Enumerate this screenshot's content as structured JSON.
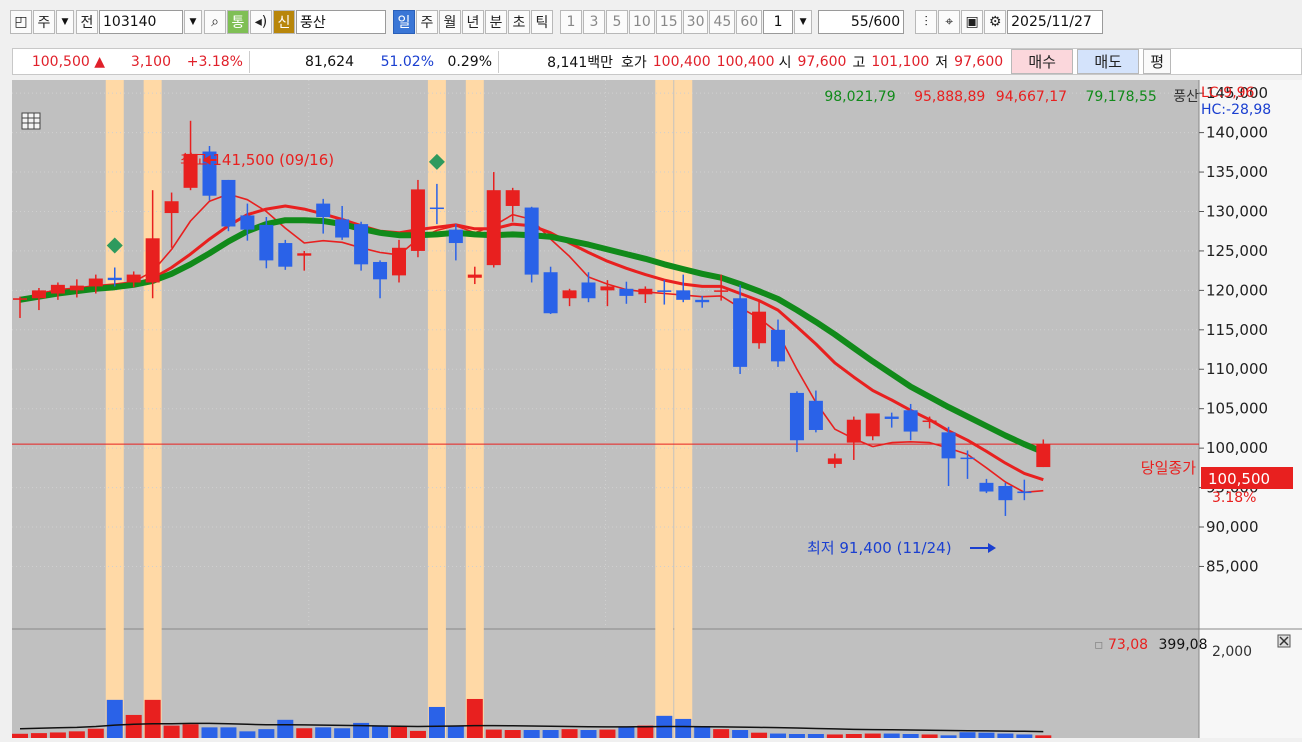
{
  "toolbar": {
    "period_primary": "주",
    "prev_label": "전",
    "code": "103140",
    "tong": "통",
    "sin": "신",
    "stock_name": "풍산",
    "periods": [
      "일",
      "주",
      "월",
      "년",
      "분",
      "초",
      "틱"
    ],
    "active_period": "일",
    "intervals": [
      "1",
      "3",
      "5",
      "10",
      "15",
      "30",
      "45",
      "60"
    ],
    "interval_value": "1",
    "count": "55",
    "count_max": "/600",
    "date": "2025/11/27"
  },
  "quote": {
    "price": "100,500",
    "change_arrow": "▲",
    "change": "3,100",
    "change_pct": "+3.18%",
    "volume": "81,624",
    "vol_ratio": "51.02%",
    "turnover_pct": "0.29%",
    "amount": "8,141백만",
    "hoga_label": "호가",
    "ask": "100,400",
    "bid": "100,400",
    "open_label": "시",
    "open": "97,600",
    "high_label": "고",
    "high": "101,100",
    "low_label": "저",
    "low": "97,600",
    "buy_label": "매수",
    "sell_label": "매도",
    "avg_label": "평"
  },
  "ma_values": {
    "ma1": "98,021,79",
    "ma2": "95,888,89",
    "ma3": "94,667,17",
    "ma4": "79,178,55",
    "name": "풍산"
  },
  "lc_label": "LC:9,96",
  "hc_label": "HC:-28,98",
  "current_label": "당일종가",
  "current_price": "100,500",
  "current_pct": "3.18%",
  "high_note": "최고 141,500 (09/16)",
  "low_note": "최저 91,400 (11/24)",
  "vol_labels": {
    "v1": "73,08",
    "v2": "399,08",
    "tick": "2,000"
  },
  "colors": {
    "up": "#e8201f",
    "down": "#2a62e8",
    "ma_red": "#e8201f",
    "ma_green": "#118a1a",
    "highlight": "#ffd9a6",
    "diamond": "#2e9a5e"
  },
  "chart_data": {
    "type": "candlestick",
    "ylim": [
      81000,
      147000
    ],
    "yticks": [
      85000,
      90000,
      95000,
      100000,
      105000,
      110000,
      115000,
      120000,
      125000,
      130000,
      135000,
      140000,
      145000
    ],
    "yticks_labels": [
      "85,000",
      "90,000",
      "95,000",
      "100,000",
      "105,000",
      "110,000",
      "115,000",
      "120,000",
      "125,000",
      "130,000",
      "135,000",
      "140,000",
      "145,000"
    ],
    "ohlc": [
      [
        118800,
        119200,
        116500,
        119000
      ],
      [
        119000,
        120300,
        117500,
        120000
      ],
      [
        119600,
        121000,
        118800,
        120700
      ],
      [
        120000,
        121400,
        119100,
        120600
      ],
      [
        120500,
        122000,
        119600,
        121500
      ],
      [
        121600,
        122900,
        120500,
        121300
      ],
      [
        121000,
        122400,
        120400,
        122000
      ],
      [
        121000,
        132700,
        119000,
        126600
      ],
      [
        129800,
        132400,
        125400,
        131300
      ],
      [
        133000,
        141500,
        132700,
        137300
      ],
      [
        137600,
        138300,
        131400,
        132000
      ],
      [
        134000,
        134000,
        127500,
        128100
      ],
      [
        129500,
        131000,
        126300,
        127700
      ],
      [
        128300,
        129300,
        122800,
        123800
      ],
      [
        126000,
        126400,
        122600,
        123000
      ],
      [
        124400,
        125000,
        122500,
        124700
      ],
      [
        131000,
        131600,
        127200,
        129300
      ],
      [
        129000,
        130700,
        126400,
        126700
      ],
      [
        128400,
        128700,
        122500,
        123300
      ],
      [
        123600,
        123800,
        119000,
        121400
      ],
      [
        121900,
        126400,
        121000,
        125400
      ],
      [
        125000,
        134000,
        124200,
        132800
      ],
      [
        130500,
        133500,
        128400,
        130400
      ],
      [
        127700,
        128400,
        123800,
        126000
      ],
      [
        121600,
        123000,
        120800,
        122000
      ],
      [
        123200,
        135000,
        122900,
        132700
      ],
      [
        130700,
        133000,
        128700,
        132700
      ],
      [
        130500,
        130600,
        121000,
        122000
      ],
      [
        122300,
        123000,
        117000,
        117100
      ],
      [
        119000,
        120200,
        118000,
        120000
      ],
      [
        121000,
        122300,
        118500,
        119000
      ],
      [
        120000,
        121300,
        118000,
        120500
      ],
      [
        120200,
        121100,
        118300,
        119300
      ],
      [
        119500,
        120500,
        118400,
        120200
      ],
      [
        120000,
        121300,
        118200,
        119800
      ],
      [
        120000,
        122000,
        118500,
        118800
      ],
      [
        118800,
        119300,
        117800,
        118500
      ],
      [
        120000,
        122000,
        118700,
        120000
      ],
      [
        119000,
        120700,
        109400,
        110300
      ],
      [
        113300,
        118600,
        112600,
        117300
      ],
      [
        115000,
        116300,
        110300,
        111000
      ],
      [
        107000,
        107200,
        99500,
        101000
      ],
      [
        106000,
        107300,
        102000,
        102300
      ],
      [
        98000,
        99300,
        97500,
        98700
      ],
      [
        100700,
        104000,
        98500,
        103600
      ],
      [
        101500,
        104000,
        101000,
        104400
      ],
      [
        104000,
        104500,
        102600,
        103700
      ],
      [
        104800,
        105600,
        101000,
        102100
      ],
      [
        103400,
        104000,
        102500,
        103500
      ],
      [
        102000,
        102700,
        95200,
        98700
      ],
      [
        98800,
        99700,
        96100,
        98700
      ],
      [
        95600,
        96100,
        94300,
        94500
      ],
      [
        95200,
        95600,
        91400,
        93400
      ],
      [
        94500,
        96000,
        93400,
        94300
      ],
      [
        97600,
        101100,
        97600,
        100500
      ]
    ],
    "ma_red_thin": [
      118800,
      119600,
      120100,
      120300,
      120600,
      120800,
      121100,
      122400,
      125200,
      128800,
      131300,
      132200,
      131500,
      130000,
      127900,
      126000,
      126300,
      126100,
      125400,
      124800,
      124500,
      126500,
      127600,
      128200,
      127300,
      128200,
      129600,
      129000,
      126500,
      124300,
      121700,
      120800,
      120100,
      119800,
      119600,
      119400,
      119200,
      119300,
      117800,
      116500,
      114600,
      110000,
      105800,
      102400,
      101200,
      100200,
      100700,
      100800,
      100700,
      100000,
      99200,
      97500,
      95700,
      94400,
      94600
    ],
    "ma_red_thick": [
      118800,
      119200,
      119600,
      120000,
      120200,
      120500,
      120800,
      121500,
      122900,
      124600,
      126500,
      128200,
      129600,
      130300,
      130700,
      130300,
      129700,
      129000,
      128200,
      127500,
      127300,
      127700,
      128000,
      128300,
      127800,
      127800,
      128400,
      128200,
      127300,
      126000,
      124800,
      123700,
      122800,
      122000,
      121300,
      120800,
      120500,
      120500,
      119600,
      118700,
      117500,
      115400,
      113200,
      110800,
      109000,
      107300,
      106100,
      104800,
      103600,
      102200,
      101000,
      99600,
      98100,
      96800,
      96000
    ],
    "ma_green": [
      118800,
      119200,
      119600,
      119900,
      120200,
      120400,
      120700,
      121200,
      122100,
      123300,
      124700,
      126200,
      127500,
      128400,
      128900,
      128900,
      128800,
      128400,
      127800,
      127300,
      127000,
      127000,
      127100,
      127300,
      127100,
      127000,
      127100,
      127000,
      126800,
      126300,
      125800,
      125200,
      124600,
      124000,
      123300,
      122700,
      122100,
      121600,
      120800,
      119900,
      118900,
      117500,
      116000,
      114400,
      112700,
      111000,
      109400,
      107800,
      106500,
      105200,
      104000,
      102800,
      101600,
      100500,
      99500
    ],
    "volume": [
      95,
      110,
      125,
      150,
      210,
      860,
      520,
      860,
      280,
      310,
      240,
      240,
      150,
      200,
      410,
      220,
      240,
      220,
      340,
      270,
      250,
      160,
      700,
      260,
      880,
      190,
      180,
      180,
      180,
      200,
      180,
      190,
      240,
      280,
      500,
      430,
      270,
      200,
      180,
      120,
      100,
      90,
      90,
      80,
      90,
      100,
      100,
      90,
      80,
      60,
      130,
      120,
      100,
      80,
      60
    ],
    "volume_ma": [
      210,
      220,
      230,
      240,
      260,
      290,
      310,
      320,
      320,
      330,
      330,
      320,
      310,
      300,
      300,
      295,
      290,
      285,
      280,
      270,
      265,
      260,
      265,
      270,
      280,
      280,
      275,
      270,
      265,
      260,
      255,
      250,
      250,
      255,
      260,
      260,
      255,
      250,
      245,
      240,
      235,
      225,
      215,
      205,
      195,
      190,
      185,
      180,
      175,
      170,
      165,
      160,
      155,
      150,
      145
    ],
    "volume_ylim": [
      0,
      2300
    ],
    "highlight_bars": [
      5,
      7,
      22,
      24,
      34,
      35
    ],
    "diamond_bars": [
      5,
      22
    ]
  }
}
